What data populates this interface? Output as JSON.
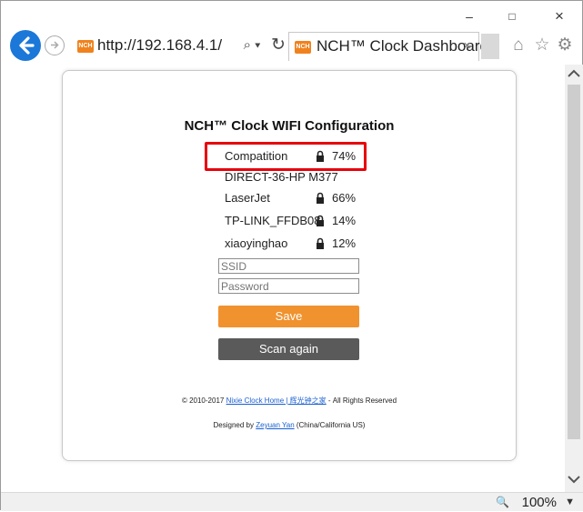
{
  "window": {
    "minimize": "–",
    "maximize": "□",
    "close": "×"
  },
  "address": {
    "url": "http://192.168.4.1/",
    "search_glyph": "⌕ ▾",
    "refresh_glyph": "↻"
  },
  "favicon_text": "NCH",
  "tab": {
    "title": "NCH™ Clock Dashboard",
    "close": "×"
  },
  "toolbar": {
    "home": "⌂",
    "favorites": "☆",
    "settings": "⚙"
  },
  "page": {
    "title": "NCH™ Clock WIFI Configuration",
    "networks": [
      {
        "ssid": "Compatition",
        "secured": true,
        "signal": "74%"
      },
      {
        "ssid": "DIRECT-36-HP M377",
        "secured": false,
        "signal": ""
      },
      {
        "ssid": "LaserJet",
        "secured": true,
        "signal": "66%"
      },
      {
        "ssid": "TP-LINK_FFDB08",
        "secured": true,
        "signal": "14%"
      },
      {
        "ssid": "xiaoyinghao",
        "secured": true,
        "signal": "12%"
      }
    ],
    "ssid_placeholder": "SSID",
    "password_placeholder": "Password",
    "save_label": "Save",
    "scan_label": "Scan again",
    "footer1_prefix": "© 2010-2017 ",
    "footer1_link": "Nixie Clock Home | 辉光钟之家",
    "footer1_suffix": " - All Rights Reserved",
    "footer2_prefix": "Designed by ",
    "footer2_link": "Zeyuan Yan",
    "footer2_suffix": " (China/California US)"
  },
  "status": {
    "zoom": "100%",
    "zoom_icon": "🔍"
  },
  "colors": {
    "accent_blue": "#1b78d8",
    "save": "#f0922e",
    "scan": "#5a5a5a",
    "highlight": "#e8000b"
  }
}
